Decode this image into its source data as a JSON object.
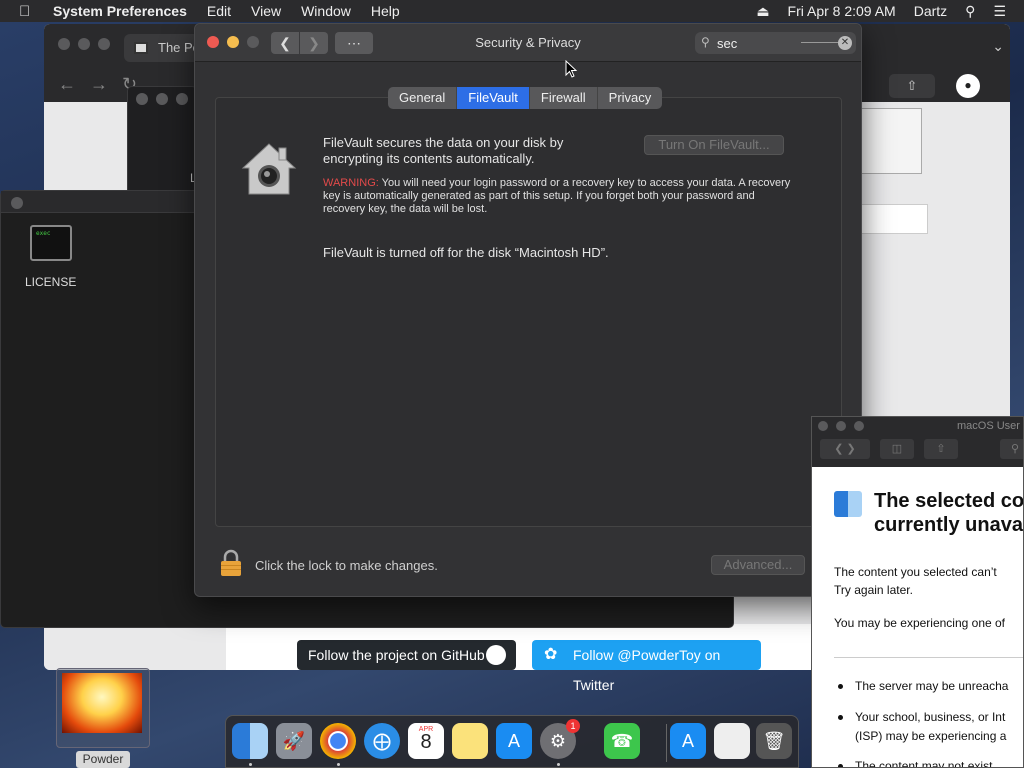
{
  "menubar": {
    "app": "System Preferences",
    "items": [
      "Edit",
      "View",
      "Window",
      "Help"
    ],
    "datetime": "Fri Apr 8  2:09 AM",
    "user": "Dartz"
  },
  "browser": {
    "tab_title": "The Po"
  },
  "desktop": {
    "license_label": "LICENSE",
    "exec_label": "exec",
    "powder_label": "Powder",
    "win2_letter": "L"
  },
  "window": {
    "title": "Security & Privacy",
    "search_value": "sec",
    "tabs": [
      {
        "label": "General",
        "active": false
      },
      {
        "label": "FileVault",
        "active": true
      },
      {
        "label": "Firewall",
        "active": false
      },
      {
        "label": "Privacy",
        "active": false
      }
    ],
    "filevault": {
      "description": "FileVault secures the data on your disk by encrypting its contents automatically.",
      "turn_on_button": "Turn On FileVault...",
      "warning_prefix": "WARNING:",
      "warning_text": " You will need your login password or a recovery key to access your data. A recovery key is automatically generated as part of this setup. If you forget both your password and recovery key, the data will be lost.",
      "status": "FileVault is turned off for the disk “Macintosh HD”."
    },
    "lock_text": "Click the lock to make changes.",
    "advanced_button": "Advanced..."
  },
  "follow": {
    "github": "Follow the project on GitHub",
    "twitter": "Follow @PowderToy on Twitter"
  },
  "help_window": {
    "title": "macOS User",
    "heading_line1": "The selected co",
    "heading_line2": "currently unava",
    "para1_line1": "The content you selected can’t",
    "para1_line2": "Try again later.",
    "para2": "You may be experiencing one of",
    "bullets": [
      [
        "The server may be unreacha"
      ],
      [
        "Your school, business, or Int",
        "(ISP) may be experiencing a"
      ],
      [
        "The content may not exist"
      ]
    ]
  },
  "dock": {
    "calendar_month": "APR",
    "calendar_day": "8",
    "sysprefs_badge": "1"
  },
  "colors": {
    "accent": "#2d6ee6",
    "warning": "#e24a4a",
    "close": "#ee5a52",
    "minimize": "#f5bd4f",
    "twitter": "#1da1f2",
    "github": "#24292e"
  }
}
